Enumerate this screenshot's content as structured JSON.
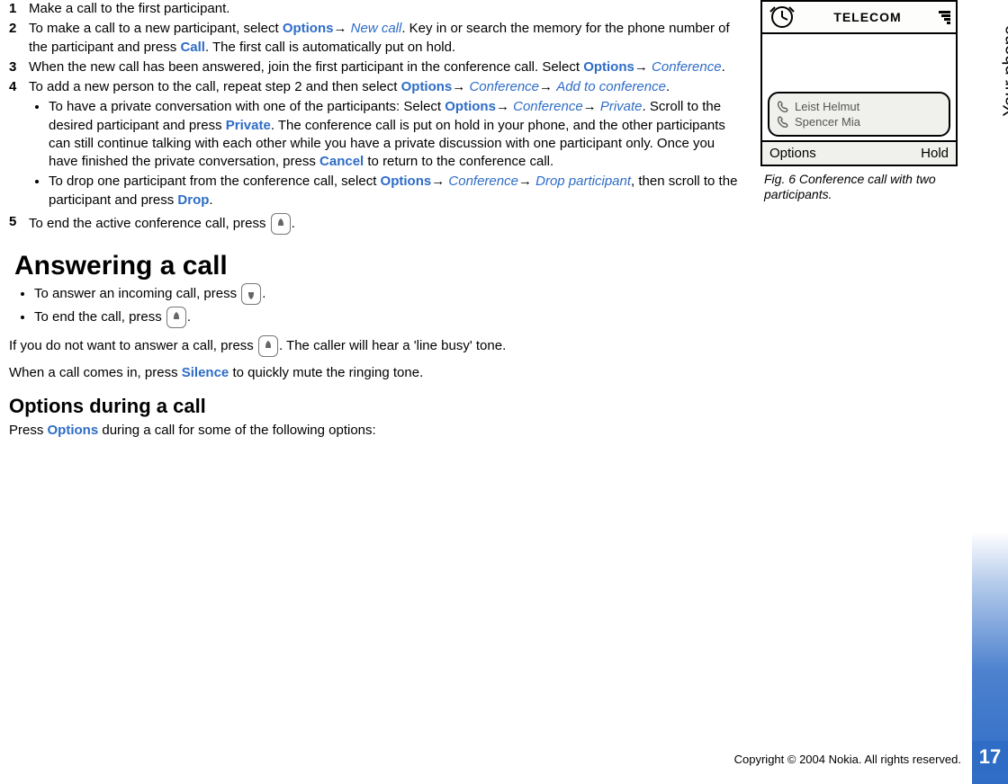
{
  "sideTab": "Your phone",
  "step1": "Make a call to the first participant.",
  "step2_a": "To make a call to a new participant, select ",
  "opt": "Options",
  "arrow": "→ ",
  "newcall": "New call",
  "step2_b": ". Key in or search the memory for the phone number of the participant and press ",
  "call": "Call",
  "step2_c": ". The first call is automatically put on hold.",
  "step3_a": "When the new call has been answered, join the first participant in the conference call. Select ",
  "conference": "Conference",
  "period": ".",
  "step4_a": "To add a new person to the call, repeat step 2 and then select ",
  "addconf": "Add to conference",
  "b1_a": "To have a private conversation with one of the participants: Select ",
  "private": "Private",
  "b1_b": ". Scroll to the desired participant and press ",
  "privateBold": "Private",
  "b1_c": ". The conference call is put on hold in your phone, and the other participants can still continue talking with each other while you have a private discussion with one participant only. Once you have finished the private conversation, press ",
  "cancel": "Cancel",
  "b1_d": " to return to the conference call.",
  "b2_a": "To drop one participant from the conference call, select ",
  "dropPart": "Drop participant",
  "b2_b": ", then scroll to the participant and press ",
  "drop": "Drop",
  "step5_a": "To end the active conference call, press ",
  "h1": "Answering a call",
  "ans1": "To answer an incoming call, press ",
  "ans2": "To end the call, press ",
  "noans_a": "If you do not want to answer a call, press ",
  "noans_b": ". The caller will hear a 'line busy' tone.",
  "silence_a": "When a call comes in, press ",
  "silence": "Silence",
  "silence_b": " to quickly mute the ringing tone.",
  "h2": "Options during a call",
  "optduring_a": "Press ",
  "optduring_b": " during a call for some of the following options:",
  "copyright": "Copyright © 2004 Nokia. All rights reserved.",
  "pageNum": "17",
  "figCaption": "Fig. 6 Conference call with two participants.",
  "phone": {
    "carrier": "TELECOM",
    "p1": "Leist Helmut",
    "p2": "Spencer Mia",
    "left": "Options",
    "right": "Hold"
  }
}
